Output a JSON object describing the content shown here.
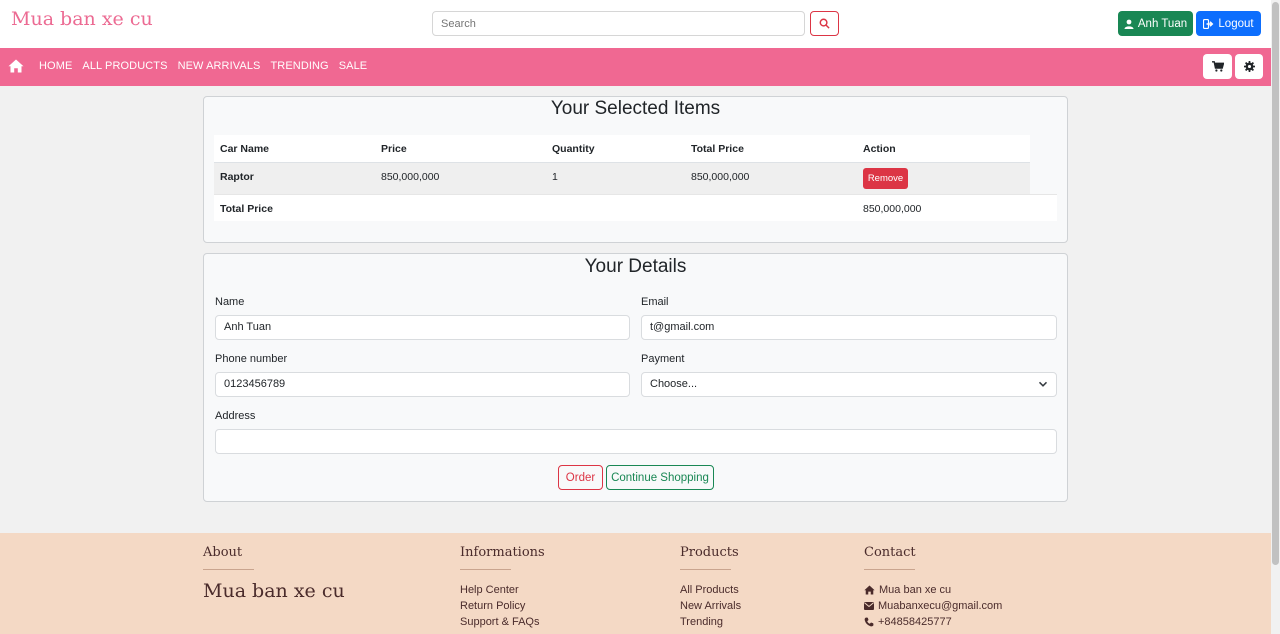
{
  "header": {
    "brand": "Mua ban xe cu",
    "search_placeholder": "Search",
    "user_label": "Anh Tuan",
    "logout_label": "Logout"
  },
  "nav": {
    "items": [
      "HOME",
      "ALL PRODUCTS",
      "NEW ARRIVALS",
      "TRENDING",
      "SALE"
    ]
  },
  "cart": {
    "title": "Your Selected Items",
    "columns": [
      "Car Name",
      "Price",
      "Quantity",
      "Total Price",
      "Action"
    ],
    "rows": [
      {
        "car_name": "Raptor",
        "price": "850,000,000",
        "quantity": "1",
        "total_price": "850,000,000",
        "action": "Remove"
      }
    ],
    "total_label": "Total Price",
    "total_value": "850,000,000"
  },
  "details": {
    "title": "Your Details",
    "name_label": "Name",
    "name_value": "Anh Tuan",
    "email_label": "Email",
    "email_value": "t@gmail.com",
    "phone_label": "Phone number",
    "phone_value": "0123456789",
    "payment_label": "Payment",
    "payment_value": "Choose...",
    "address_label": "Address",
    "address_value": "",
    "order_label": "Order",
    "continue_label": "Continue Shopping"
  },
  "footer": {
    "about_title": "About",
    "about_brand": "Mua ban xe cu",
    "info_title": "Informations",
    "info_links": [
      "Help Center",
      "Return Policy",
      "Support & FAQs"
    ],
    "products_title": "Products",
    "products_links": [
      "All Products",
      "New Arrivals",
      "Trending"
    ],
    "contact_title": "Contact",
    "contact_name": "Mua ban xe cu",
    "contact_email": "Muabanxecu@gmail.com",
    "contact_phone": "+84858425777"
  },
  "colors": {
    "brand_pink": "#f06892",
    "footer_bg": "#f4d9c5",
    "danger": "#dc3545",
    "success": "#198754",
    "primary": "#0d6efd"
  }
}
